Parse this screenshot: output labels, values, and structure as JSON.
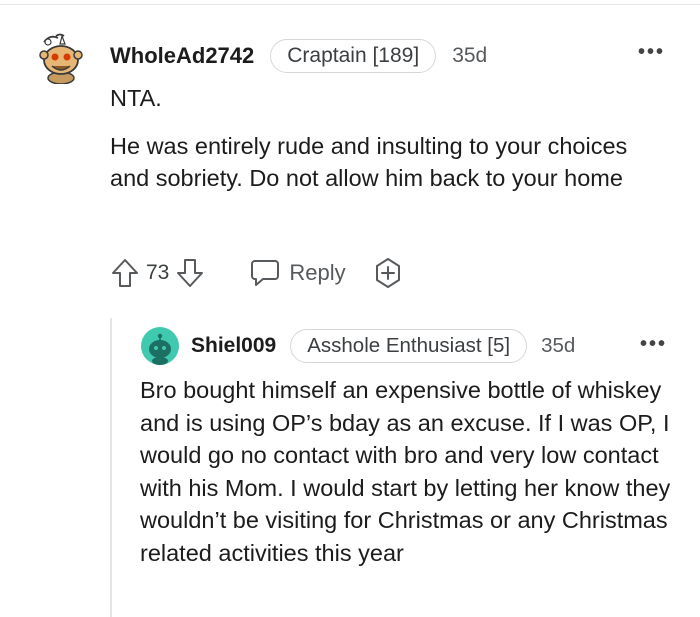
{
  "comment": {
    "username": "WholeAd2742",
    "flair": "Craptain [189]",
    "age": "35d",
    "more_glyph": "•••",
    "body": [
      "NTA.",
      "He was entirely rude and insulting to your choices and sobriety. Do not allow him back to your home"
    ],
    "votes": "73",
    "reply_label": "Reply",
    "avatar_icon": "snoo-avatar-icon"
  },
  "reply": {
    "username": "Shiel009",
    "flair": "Asshole Enthusiast [5]",
    "age": "35d",
    "more_glyph": "•••",
    "body": "Bro bought himself an expensive bottle of whiskey and is using OP’s bday as an excuse. If I was OP, I would go no contact with bro and very low contact with his Mom. I would start by letting her know they wouldn’t be visiting for Christmas or any Christmas related activities this year",
    "avatar_icon": "snoo-avatar-icon"
  },
  "colors": {
    "text": "#1c1c1c",
    "meta": "#575a5d",
    "flair_border": "#d4d7da",
    "avatar2_bg": "#41c9b0"
  }
}
